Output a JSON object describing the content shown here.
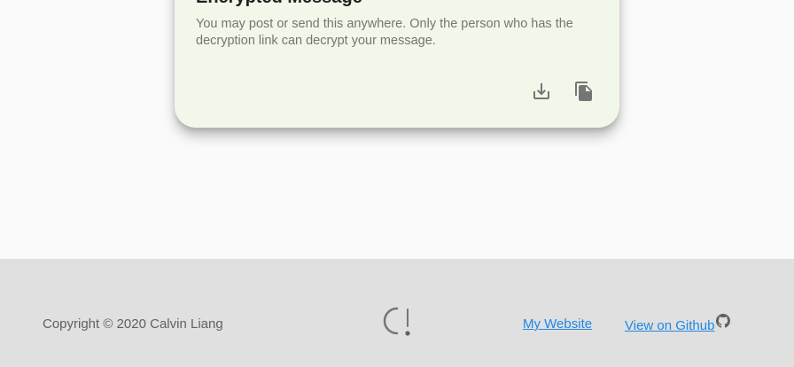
{
  "card": {
    "title": "Encrypted Message",
    "description": "You may post or send this anywhere. Only the person who has the decryption link can decrypt your message.",
    "background": "#f1f8e9",
    "actions": [
      {
        "icon": "download-icon"
      },
      {
        "icon": "copy-icon"
      }
    ]
  },
  "footer": {
    "copyright": "Copyright © 2020 Calvin Liang",
    "logo_icon": "app-logo-icon",
    "links": {
      "website": "My Website",
      "github": "View on Github"
    },
    "github_icon": "github-icon",
    "link_color": "#1e88e5",
    "background": "#e0e0e0"
  }
}
